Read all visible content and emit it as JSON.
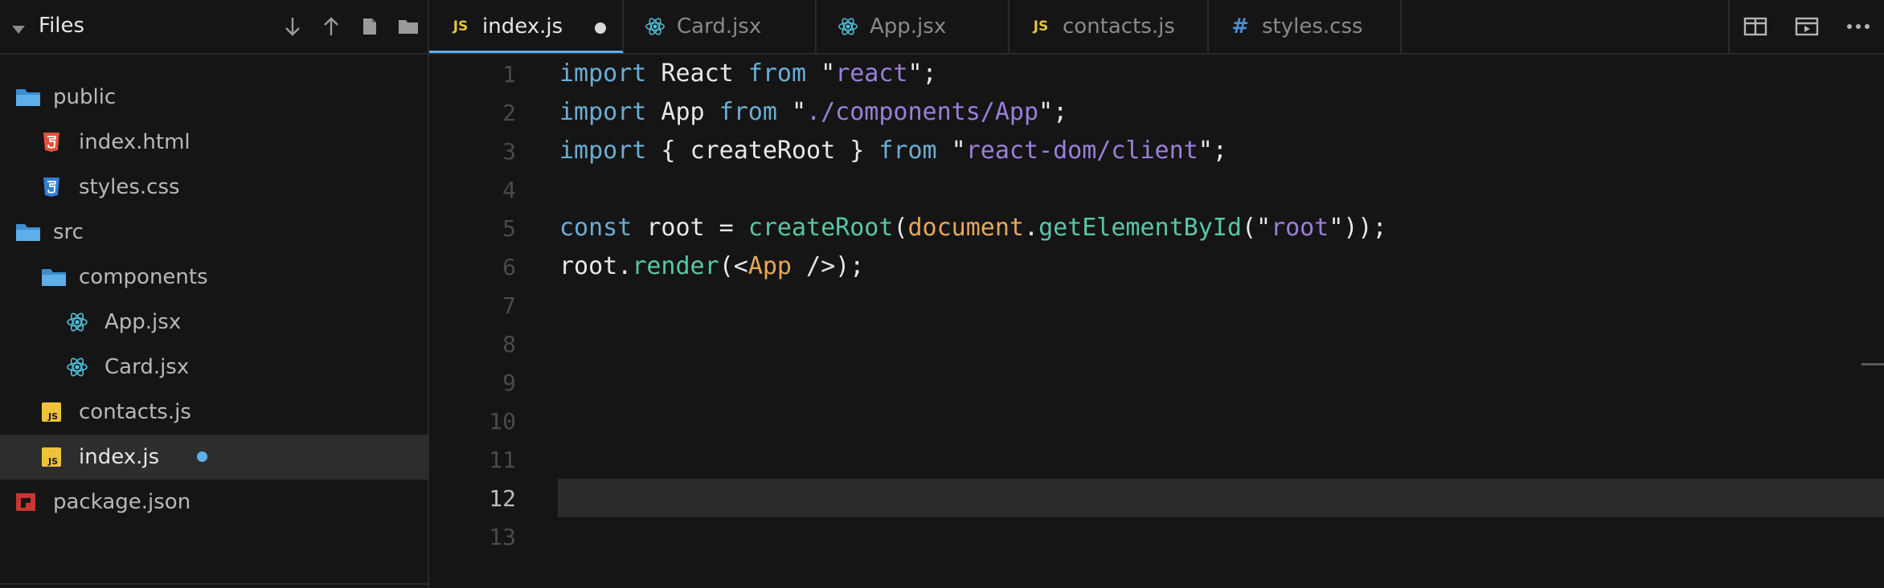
{
  "sidebar": {
    "title": "Files",
    "actions": [
      "download-icon",
      "upload-icon",
      "new-file-icon",
      "new-folder-icon"
    ],
    "tree": [
      {
        "label": "public",
        "icon": "folder-icon",
        "depth": 0
      },
      {
        "label": "index.html",
        "icon": "html5-icon",
        "depth": 1
      },
      {
        "label": "styles.css",
        "icon": "css3-icon",
        "depth": 1
      },
      {
        "label": "src",
        "icon": "folder-icon",
        "depth": 0
      },
      {
        "label": "components",
        "icon": "folder-icon",
        "depth": 1
      },
      {
        "label": "App.jsx",
        "icon": "react-icon",
        "depth": 2
      },
      {
        "label": "Card.jsx",
        "icon": "react-icon",
        "depth": 2
      },
      {
        "label": "contacts.js",
        "icon": "js-icon",
        "depth": 1
      },
      {
        "label": "index.js",
        "icon": "js-icon",
        "depth": 1,
        "active": true,
        "modified": true
      },
      {
        "label": "package.json",
        "icon": "npm-icon",
        "depth": 0
      }
    ]
  },
  "tabs": [
    {
      "label": "index.js",
      "icon": "js-icon",
      "active": true,
      "modified": true
    },
    {
      "label": "Card.jsx",
      "icon": "react-icon"
    },
    {
      "label": "App.jsx",
      "icon": "react-icon"
    },
    {
      "label": "contacts.js",
      "icon": "js-icon"
    },
    {
      "label": "styles.css",
      "icon": "css-hash-icon"
    }
  ],
  "tab_actions": [
    "split-view-icon",
    "preview-icon",
    "more-options-icon"
  ],
  "badges": {
    "js": "JS",
    "css": "#"
  },
  "colors": {
    "accent": "#5cb0e8",
    "keyword": "#6aaed6",
    "string": "#9b7fd9",
    "function": "#58c6a8",
    "object": "#e8a758"
  },
  "editor": {
    "current_line": 12,
    "line_numbers": [
      "1",
      "2",
      "3",
      "4",
      "5",
      "6",
      "7",
      "8",
      "9",
      "10",
      "11",
      "12",
      "13"
    ],
    "lines": [
      [
        {
          "t": "import",
          "c": "kw"
        },
        {
          "t": " React ",
          "c": "pun"
        },
        {
          "t": "from",
          "c": "kw"
        },
        {
          "t": " \"",
          "c": "pun"
        },
        {
          "t": "react",
          "c": "str"
        },
        {
          "t": "\";",
          "c": "pun"
        }
      ],
      [
        {
          "t": "import",
          "c": "kw"
        },
        {
          "t": " App ",
          "c": "pun"
        },
        {
          "t": "from",
          "c": "kw"
        },
        {
          "t": " \"",
          "c": "pun"
        },
        {
          "t": "./components/App",
          "c": "str"
        },
        {
          "t": "\";",
          "c": "pun"
        }
      ],
      [
        {
          "t": "import",
          "c": "kw"
        },
        {
          "t": " { ",
          "c": "pun"
        },
        {
          "t": "createRoot",
          "c": "pun"
        },
        {
          "t": " } ",
          "c": "pun"
        },
        {
          "t": "from",
          "c": "kw"
        },
        {
          "t": " \"",
          "c": "pun"
        },
        {
          "t": "react-dom/client",
          "c": "str"
        },
        {
          "t": "\";",
          "c": "pun"
        }
      ],
      [],
      [
        {
          "t": "const",
          "c": "kw"
        },
        {
          "t": " root = ",
          "c": "pun"
        },
        {
          "t": "createRoot",
          "c": "fn"
        },
        {
          "t": "(",
          "c": "pun"
        },
        {
          "t": "document",
          "c": "obj"
        },
        {
          "t": ".",
          "c": "pun"
        },
        {
          "t": "getElementById",
          "c": "fn"
        },
        {
          "t": "(\"",
          "c": "pun"
        },
        {
          "t": "root",
          "c": "str"
        },
        {
          "t": "\"));",
          "c": "pun"
        }
      ],
      [
        {
          "t": "root.",
          "c": "pun"
        },
        {
          "t": "render",
          "c": "fn"
        },
        {
          "t": "(<",
          "c": "pun"
        },
        {
          "t": "App",
          "c": "obj"
        },
        {
          "t": " />);",
          "c": "pun"
        }
      ],
      [],
      [],
      [],
      [],
      [],
      [],
      []
    ]
  }
}
